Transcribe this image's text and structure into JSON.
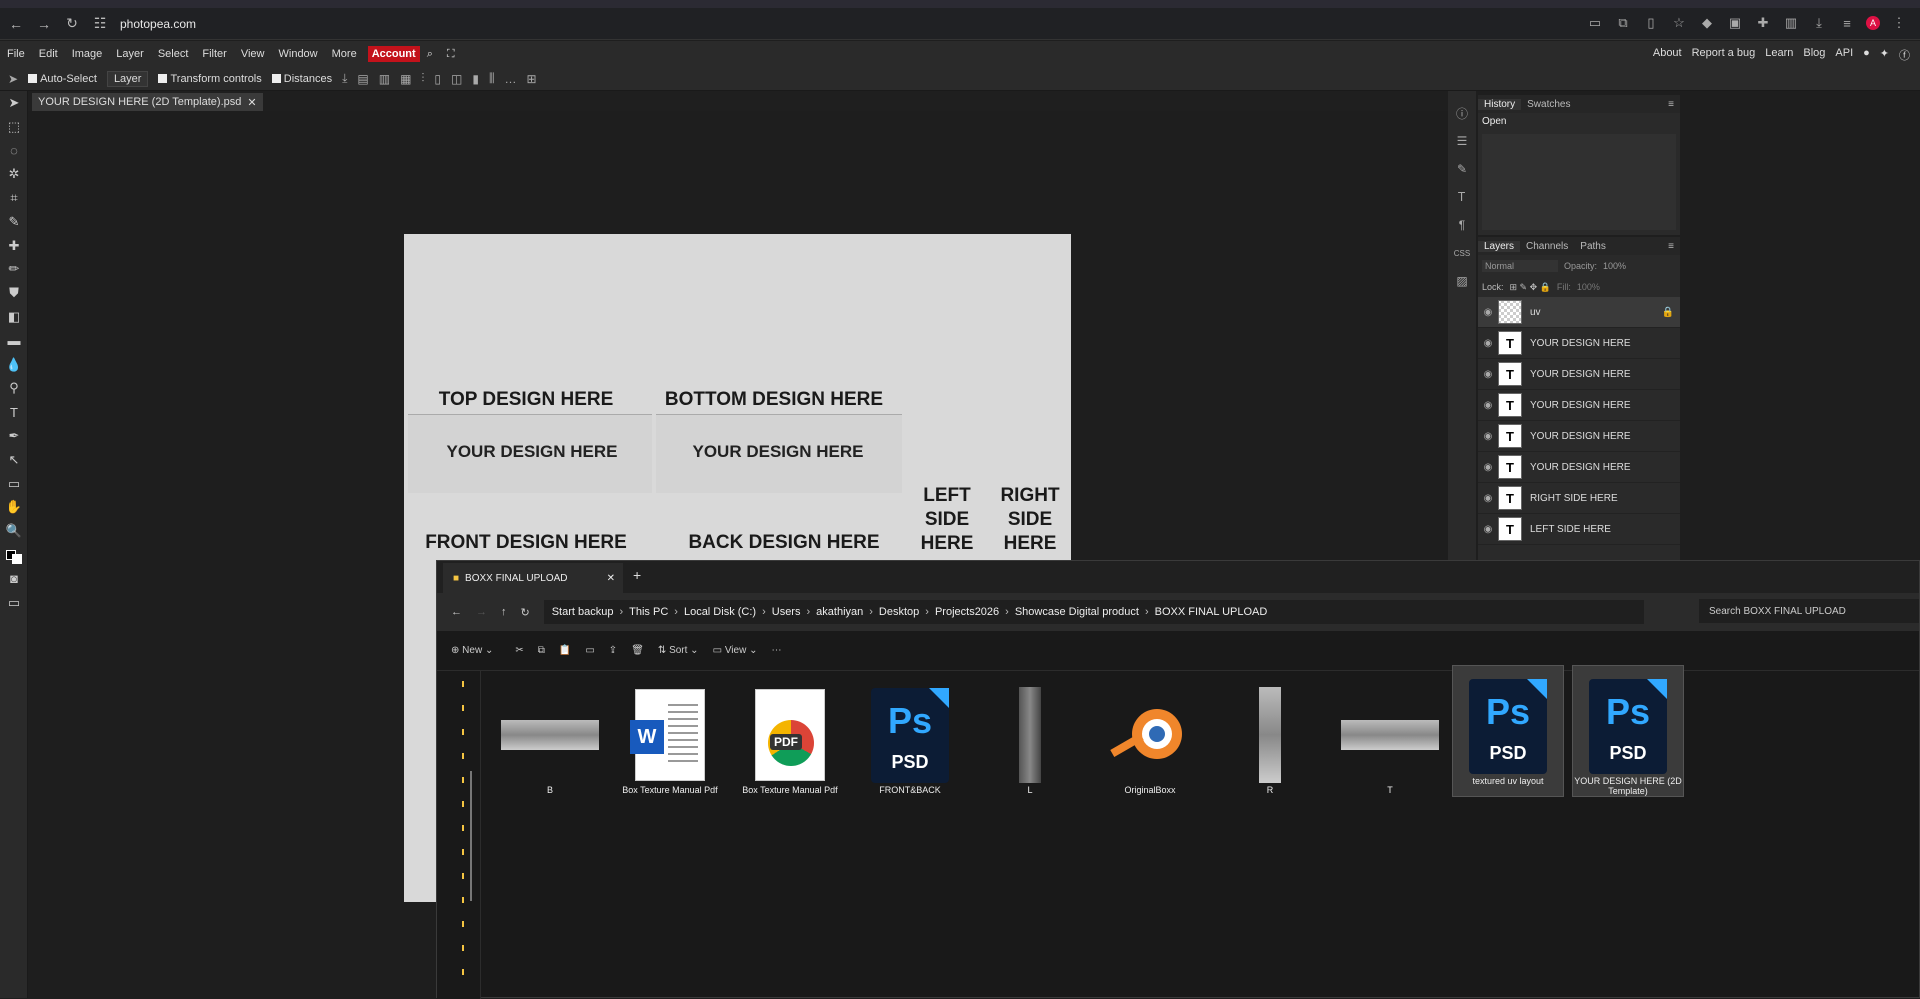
{
  "browser": {
    "url": "photopea.com"
  },
  "menu": {
    "items": [
      "File",
      "Edit",
      "Image",
      "Layer",
      "Select",
      "Filter",
      "View",
      "Window",
      "More"
    ],
    "account": "Account",
    "right": [
      "About",
      "Report a bug",
      "Learn",
      "Blog",
      "API"
    ]
  },
  "options": {
    "auto_select": "Auto-Select",
    "layer_select": "Layer",
    "transform": "Transform controls",
    "distances": "Distances"
  },
  "doc_tab": "YOUR DESIGN HERE (2D Template).psd",
  "canvas": {
    "top": "TOP DESIGN HERE",
    "bottom": "BOTTOM DESIGN HERE",
    "your1": "YOUR DESIGN HERE",
    "your2": "YOUR DESIGN HERE",
    "left": "LEFT SIDE HERE",
    "right": "RIGHT SIDE HERE",
    "front": "FRONT DESIGN HERE",
    "back": "BACK DESIGN HERE"
  },
  "history": {
    "tabs": [
      "History",
      "Swatches"
    ],
    "items": [
      "Open"
    ]
  },
  "layers": {
    "tabs": [
      "Layers",
      "Channels",
      "Paths"
    ],
    "blend": "Normal",
    "opacity_label": "Opacity:",
    "opacity": "100%",
    "lock_label": "Lock:",
    "fill_label": "Fill:",
    "fill": "100%",
    "rows": [
      {
        "name": "uv",
        "thumb": ""
      },
      {
        "name": "YOUR DESIGN HERE",
        "thumb": "T"
      },
      {
        "name": "YOUR DESIGN HERE",
        "thumb": "T"
      },
      {
        "name": "YOUR DESIGN HERE",
        "thumb": "T"
      },
      {
        "name": "YOUR DESIGN HERE",
        "thumb": "T"
      },
      {
        "name": "YOUR DESIGN HERE",
        "thumb": "T"
      },
      {
        "name": "RIGHT SIDE HERE",
        "thumb": "T"
      },
      {
        "name": "LEFT SIDE HERE",
        "thumb": "T"
      }
    ]
  },
  "explorer": {
    "tab": "BOXX FINAL UPLOAD",
    "crumbs": [
      "Start backup",
      "This PC",
      "Local Disk (C:)",
      "Users",
      "akathiyan",
      "Desktop",
      "Projects2026",
      "Showcase Digital product",
      "BOXX FINAL UPLOAD"
    ],
    "search": "Search BOXX FINAL UPLOAD",
    "cmd": {
      "new": "New",
      "sort": "Sort",
      "view": "View"
    },
    "files": [
      {
        "name": "B"
      },
      {
        "name": "Box Texture Manual Pdf"
      },
      {
        "name": "Box Texture Manual Pdf"
      },
      {
        "name": "FRONT&BACK"
      },
      {
        "name": "L"
      },
      {
        "name": "OriginalBoxx"
      },
      {
        "name": "R"
      },
      {
        "name": "T"
      },
      {
        "name": "textured uv layout"
      },
      {
        "name": "YOUR DESIGN HERE (2D Template)"
      }
    ],
    "word_letter": "W",
    "pdf_label": "PDF",
    "ps_letters": "Ps",
    "ps_type": "PSD"
  }
}
